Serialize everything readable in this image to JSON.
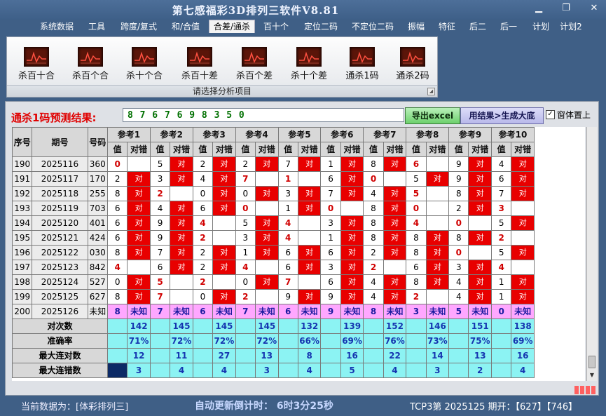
{
  "window": {
    "title": "第七感福彩3D排列三软件V8.81",
    "min_icon": "minimize-icon",
    "max_icon": "maximize-icon",
    "close_icon": "close-icon"
  },
  "menu": [
    {
      "label": "系统数据",
      "active": false
    },
    {
      "label": "工具",
      "active": false
    },
    {
      "label": "跨度/复式",
      "active": false
    },
    {
      "label": "和/合值",
      "active": false
    },
    {
      "label": "合差/通杀",
      "active": true
    },
    {
      "label": "百十个",
      "active": false
    },
    {
      "label": "定位二码",
      "active": false
    },
    {
      "label": "不定位二码",
      "active": false
    },
    {
      "label": "振幅",
      "active": false
    },
    {
      "label": "特征",
      "active": false
    },
    {
      "label": "后二",
      "active": false
    },
    {
      "label": "后一",
      "active": false
    },
    {
      "label": "计划",
      "active": false
    },
    {
      "label": "计划2",
      "active": false
    }
  ],
  "ribbon": {
    "items": [
      "杀百十合",
      "杀百个合",
      "杀十个合",
      "杀百十差",
      "杀百个差",
      "杀十个差",
      "通杀1码",
      "通杀2码"
    ],
    "icon": "chart-monitor-icon",
    "caption": "请选择分析项目"
  },
  "prediction": {
    "label": "通杀1码预测结果:",
    "value": "8 7 6 7 6 9 8 3 5 0",
    "export_label": "导出excel",
    "generate_label": "用结果>生成大底",
    "ontop_label": "窗体置上",
    "ontop_checked": true
  },
  "table": {
    "headers": {
      "seq": "序号",
      "period": "期号",
      "number": "号码",
      "val": "值",
      "mark": "对错"
    },
    "refs": [
      "参考1",
      "参考2",
      "参考3",
      "参考4",
      "参考5",
      "参考6",
      "参考7",
      "参考8",
      "参考9",
      "参考10"
    ],
    "mark_ok": "对",
    "rows": [
      {
        "seq": "190",
        "period": "2025116",
        "number": "360",
        "cells": [
          [
            "0",
            "",
            1
          ],
          [
            "5",
            "对",
            0
          ],
          [
            "2",
            "对",
            0
          ],
          [
            "2",
            "对",
            0
          ],
          [
            "7",
            "对",
            0
          ],
          [
            "1",
            "对",
            0
          ],
          [
            "8",
            "对",
            0
          ],
          [
            "6",
            "",
            1
          ],
          [
            "9",
            "对",
            0
          ],
          [
            "4",
            "对",
            0
          ]
        ]
      },
      {
        "seq": "191",
        "period": "2025117",
        "number": "170",
        "cells": [
          [
            "2",
            "对",
            0
          ],
          [
            "3",
            "对",
            0
          ],
          [
            "4",
            "对",
            0
          ],
          [
            "7",
            "",
            1
          ],
          [
            "1",
            "",
            1
          ],
          [
            "6",
            "对",
            0
          ],
          [
            "0",
            "",
            1
          ],
          [
            "5",
            "对",
            0
          ],
          [
            "9",
            "对",
            0
          ],
          [
            "6",
            "对",
            0
          ]
        ]
      },
      {
        "seq": "192",
        "period": "2025118",
        "number": "255",
        "cells": [
          [
            "8",
            "对",
            0
          ],
          [
            "2",
            "",
            1
          ],
          [
            "0",
            "对",
            0
          ],
          [
            "0",
            "对",
            0
          ],
          [
            "3",
            "对",
            0
          ],
          [
            "7",
            "对",
            0
          ],
          [
            "4",
            "对",
            0
          ],
          [
            "5",
            "",
            1
          ],
          [
            "8",
            "对",
            0
          ],
          [
            "7",
            "对",
            0
          ]
        ]
      },
      {
        "seq": "193",
        "period": "2025119",
        "number": "703",
        "cells": [
          [
            "6",
            "对",
            0
          ],
          [
            "4",
            "对",
            0
          ],
          [
            "6",
            "对",
            0
          ],
          [
            "0",
            "",
            1
          ],
          [
            "1",
            "对",
            0
          ],
          [
            "0",
            "",
            1
          ],
          [
            "8",
            "对",
            0
          ],
          [
            "0",
            "",
            1
          ],
          [
            "2",
            "对",
            0
          ],
          [
            "3",
            "",
            1
          ]
        ]
      },
      {
        "seq": "194",
        "period": "2025120",
        "number": "401",
        "cells": [
          [
            "6",
            "对",
            0
          ],
          [
            "9",
            "对",
            0
          ],
          [
            "4",
            "",
            1
          ],
          [
            "5",
            "对",
            0
          ],
          [
            "4",
            "",
            1
          ],
          [
            "3",
            "对",
            0
          ],
          [
            "8",
            "对",
            0
          ],
          [
            "4",
            "",
            1
          ],
          [
            "0",
            "",
            1
          ],
          [
            "5",
            "对",
            0
          ]
        ]
      },
      {
        "seq": "195",
        "period": "2025121",
        "number": "424",
        "cells": [
          [
            "6",
            "对",
            0
          ],
          [
            "9",
            "对",
            0
          ],
          [
            "2",
            "",
            1
          ],
          [
            "3",
            "对",
            0
          ],
          [
            "4",
            "",
            1
          ],
          [
            "1",
            "对",
            0
          ],
          [
            "8",
            "对",
            0
          ],
          [
            "8",
            "对",
            0
          ],
          [
            "8",
            "对",
            0
          ],
          [
            "2",
            "",
            1
          ]
        ]
      },
      {
        "seq": "196",
        "period": "2025122",
        "number": "030",
        "cells": [
          [
            "8",
            "对",
            0
          ],
          [
            "7",
            "对",
            0
          ],
          [
            "2",
            "对",
            0
          ],
          [
            "1",
            "对",
            0
          ],
          [
            "6",
            "对",
            0
          ],
          [
            "6",
            "对",
            0
          ],
          [
            "2",
            "对",
            0
          ],
          [
            "8",
            "对",
            0
          ],
          [
            "0",
            "",
            1
          ],
          [
            "5",
            "对",
            0
          ]
        ]
      },
      {
        "seq": "197",
        "period": "2025123",
        "number": "842",
        "cells": [
          [
            "4",
            "",
            1
          ],
          [
            "6",
            "对",
            0
          ],
          [
            "2",
            "对",
            0
          ],
          [
            "4",
            "",
            1
          ],
          [
            "6",
            "对",
            0
          ],
          [
            "3",
            "对",
            0
          ],
          [
            "2",
            "",
            1
          ],
          [
            "6",
            "对",
            0
          ],
          [
            "3",
            "对",
            0
          ],
          [
            "4",
            "",
            1
          ]
        ]
      },
      {
        "seq": "198",
        "period": "2025124",
        "number": "527",
        "cells": [
          [
            "0",
            "对",
            0
          ],
          [
            "5",
            "",
            1
          ],
          [
            "2",
            "",
            1
          ],
          [
            "0",
            "对",
            0
          ],
          [
            "7",
            "",
            1
          ],
          [
            "6",
            "对",
            0
          ],
          [
            "4",
            "对",
            0
          ],
          [
            "8",
            "对",
            0
          ],
          [
            "4",
            "对",
            0
          ],
          [
            "1",
            "对",
            0
          ]
        ]
      },
      {
        "seq": "199",
        "period": "2025125",
        "number": "627",
        "cells": [
          [
            "8",
            "对",
            0
          ],
          [
            "7",
            "",
            1
          ],
          [
            "0",
            "对",
            0
          ],
          [
            "2",
            "",
            1
          ],
          [
            "9",
            "对",
            0
          ],
          [
            "9",
            "对",
            0
          ],
          [
            "4",
            "对",
            0
          ],
          [
            "2",
            "",
            1
          ],
          [
            "4",
            "对",
            0
          ],
          [
            "1",
            "对",
            0
          ]
        ]
      }
    ],
    "next": {
      "seq": "200",
      "period": "2025126",
      "number": "未知",
      "values": [
        "8",
        "7",
        "6",
        "7",
        "6",
        "9",
        "8",
        "3",
        "5",
        "0"
      ],
      "mark": "未知"
    },
    "stats": [
      {
        "label": "对次数",
        "values": [
          "142",
          "145",
          "145",
          "145",
          "132",
          "139",
          "152",
          "146",
          "151",
          "138"
        ]
      },
      {
        "label": "准确率",
        "values": [
          "71%",
          "72%",
          "72%",
          "72%",
          "66%",
          "69%",
          "76%",
          "73%",
          "75%",
          "69%"
        ]
      },
      {
        "label": "最大连对数",
        "values": [
          "12",
          "11",
          "27",
          "13",
          "8",
          "16",
          "22",
          "14",
          "13",
          "16"
        ]
      },
      {
        "label": "最大连错数",
        "values": [
          "3",
          "4",
          "4",
          "3",
          "4",
          "5",
          "4",
          "3",
          "2",
          "4"
        ]
      }
    ]
  },
  "status": {
    "source": "当前数据为：[体彩排列三]",
    "countdown": "自动更新倒计时：  6时3分25秒",
    "draw": "TCP3第  2025125  期开：【627】【746】"
  }
}
